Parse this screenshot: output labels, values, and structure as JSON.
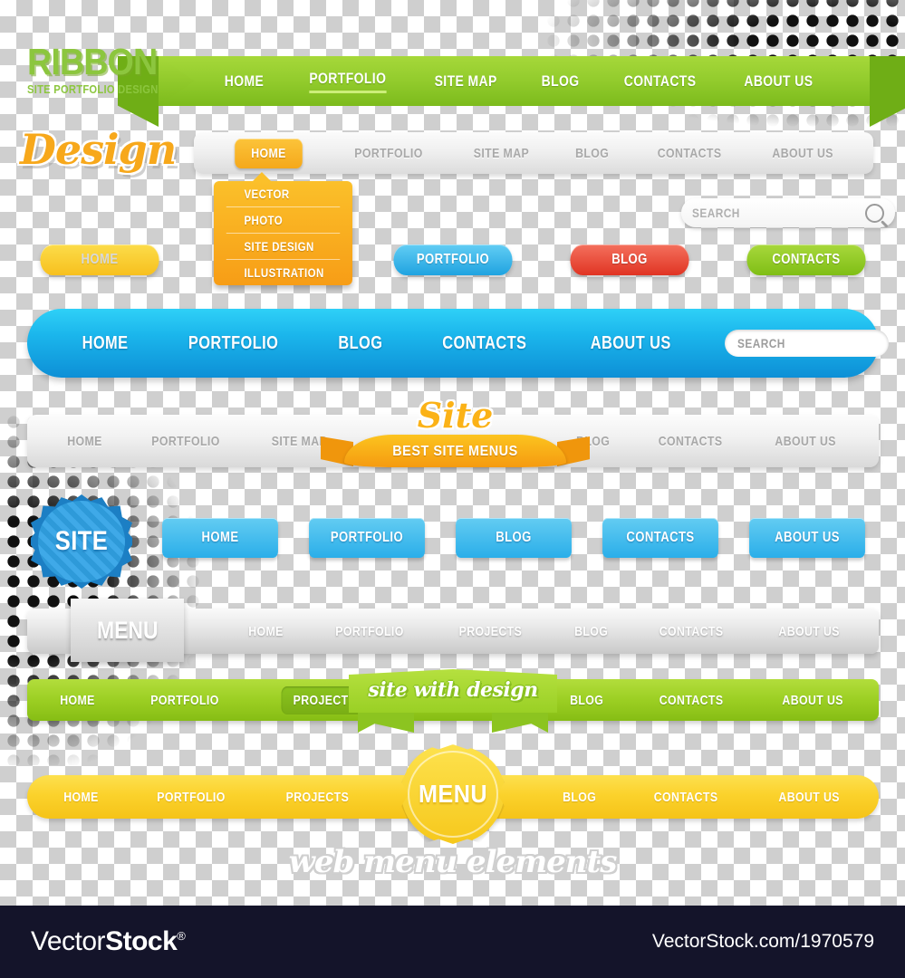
{
  "ribbon_section": {
    "logo": {
      "title": "RIBBON",
      "subtitle": "SITE PORTFOLIO DESIGN"
    },
    "nav": [
      {
        "label": "HOME",
        "active": false
      },
      {
        "label": "PORTFOLIO",
        "active": true
      },
      {
        "label": "SITE MAP",
        "active": false
      },
      {
        "label": "BLOG",
        "active": false
      },
      {
        "label": "CONTACTS",
        "active": false
      },
      {
        "label": "ABOUT US",
        "active": false
      }
    ],
    "color": "#93cc2d"
  },
  "design_section": {
    "logo": "Design",
    "nav": [
      {
        "label": "HOME",
        "active": true
      },
      {
        "label": "PORTFOLIO",
        "active": false
      },
      {
        "label": "SITE MAP",
        "active": false
      },
      {
        "label": "BLOG",
        "active": false
      },
      {
        "label": "CONTACTS",
        "active": false
      },
      {
        "label": "ABOUT US",
        "active": false
      }
    ],
    "dropdown": [
      "VECTOR",
      "PHOTO",
      "SITE DESIGN",
      "ILLUSTRATION"
    ],
    "search_placeholder": "SEARCH",
    "accent": "#f5a81b"
  },
  "pill_buttons": [
    {
      "label": "HOME",
      "color": "#f7c01e"
    },
    {
      "label": "",
      "color": "#9b18bb"
    },
    {
      "label": "PORTFOLIO",
      "color": "#1fa3e0"
    },
    {
      "label": "BLOG",
      "color": "#e03423"
    },
    {
      "label": "CONTACTS",
      "color": "#7fbe15"
    }
  ],
  "blue_bar": {
    "nav": [
      "HOME",
      "PORTFOLIO",
      "BLOG",
      "CONTACTS",
      "ABOUT US"
    ],
    "search_placeholder": "SEARCH",
    "color": "#1bb6ec"
  },
  "site_ribbon_bar": {
    "nav_left": [
      "HOME",
      "PORTFOLIO",
      "SITE MAP"
    ],
    "nav_right": [
      "BLOG",
      "CONTACTS",
      "ABOUT US"
    ],
    "badge_script": "Site",
    "badge_caption": "BEST SITE MENUS",
    "color": "#f5a81b"
  },
  "blue_buttons_row": {
    "badge": "SITE",
    "buttons": [
      "HOME",
      "PORTFOLIO",
      "BLOG",
      "CONTACTS",
      "ABOUT US"
    ],
    "color": "#2aaee9"
  },
  "menu_tab_bar": {
    "tab": "MENU",
    "nav": [
      "HOME",
      "PORTFOLIO",
      "PROJECTS",
      "BLOG",
      "CONTACTS",
      "ABOUT US"
    ]
  },
  "green_bar": {
    "nav": [
      {
        "label": "HOME",
        "active": false
      },
      {
        "label": "PORTFOLIO",
        "active": false
      },
      {
        "label": "PROJECTS",
        "active": true
      },
      {
        "label": "BLOG",
        "active": false
      },
      {
        "label": "CONTACTS",
        "active": false
      },
      {
        "label": "ABOUT US",
        "active": false
      }
    ],
    "banner_script": "site with design",
    "color": "#9ccf23"
  },
  "yellow_bar": {
    "nav": [
      "HOME",
      "PORTFOLIO",
      "PROJECTS",
      "BLOG",
      "CONTACTS",
      "ABOUT US"
    ],
    "badge": "MENU",
    "color": "#fbd22c"
  },
  "bottom_script": "web menu elements",
  "footer": {
    "brand_light": "Vector",
    "brand_bold": "Stock",
    "registered": "®",
    "url": "VectorStock.com/1970579",
    "background": "#14142a"
  }
}
